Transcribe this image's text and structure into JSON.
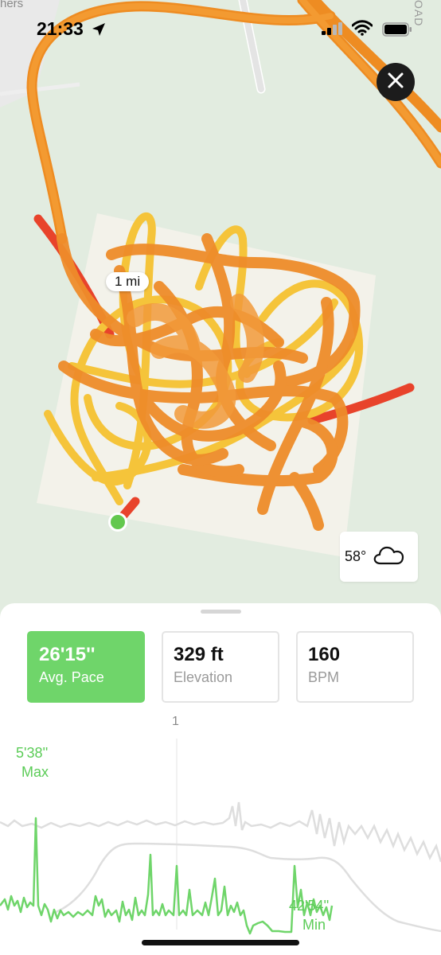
{
  "status_bar": {
    "time": "21:33",
    "icons": [
      "location-arrow-icon",
      "cellular-signal-icon",
      "wifi-icon",
      "battery-icon"
    ]
  },
  "map": {
    "poi_label": "hers",
    "road_label": "OAD",
    "mile_marker": "1 mi",
    "start_point": "green-dot",
    "colors": {
      "route_orange": "#f2952a",
      "route_yellow": "#f5c43a",
      "route_red": "#e8432b",
      "park_green": "#e2ece0",
      "field": "#f3f2ea",
      "start": "#63c84e"
    }
  },
  "close_button": {
    "icon": "close-icon"
  },
  "weather": {
    "temperature": "58°",
    "icon": "cloud-icon"
  },
  "stats": [
    {
      "value": "26'15''",
      "label": "Avg. Pace",
      "selected": true
    },
    {
      "value": "329 ft",
      "label": "Elevation",
      "selected": false
    },
    {
      "value": "160",
      "label": "BPM",
      "selected": false
    }
  ],
  "chart": {
    "mile_tick": "1",
    "max_value": "5'38''",
    "max_label": "Max",
    "min_value": "42'54''",
    "min_label": "Min",
    "colors": {
      "pace": "#6fd56a",
      "background_series": "#dcdcdc",
      "accent": "#5bcc57"
    }
  }
}
